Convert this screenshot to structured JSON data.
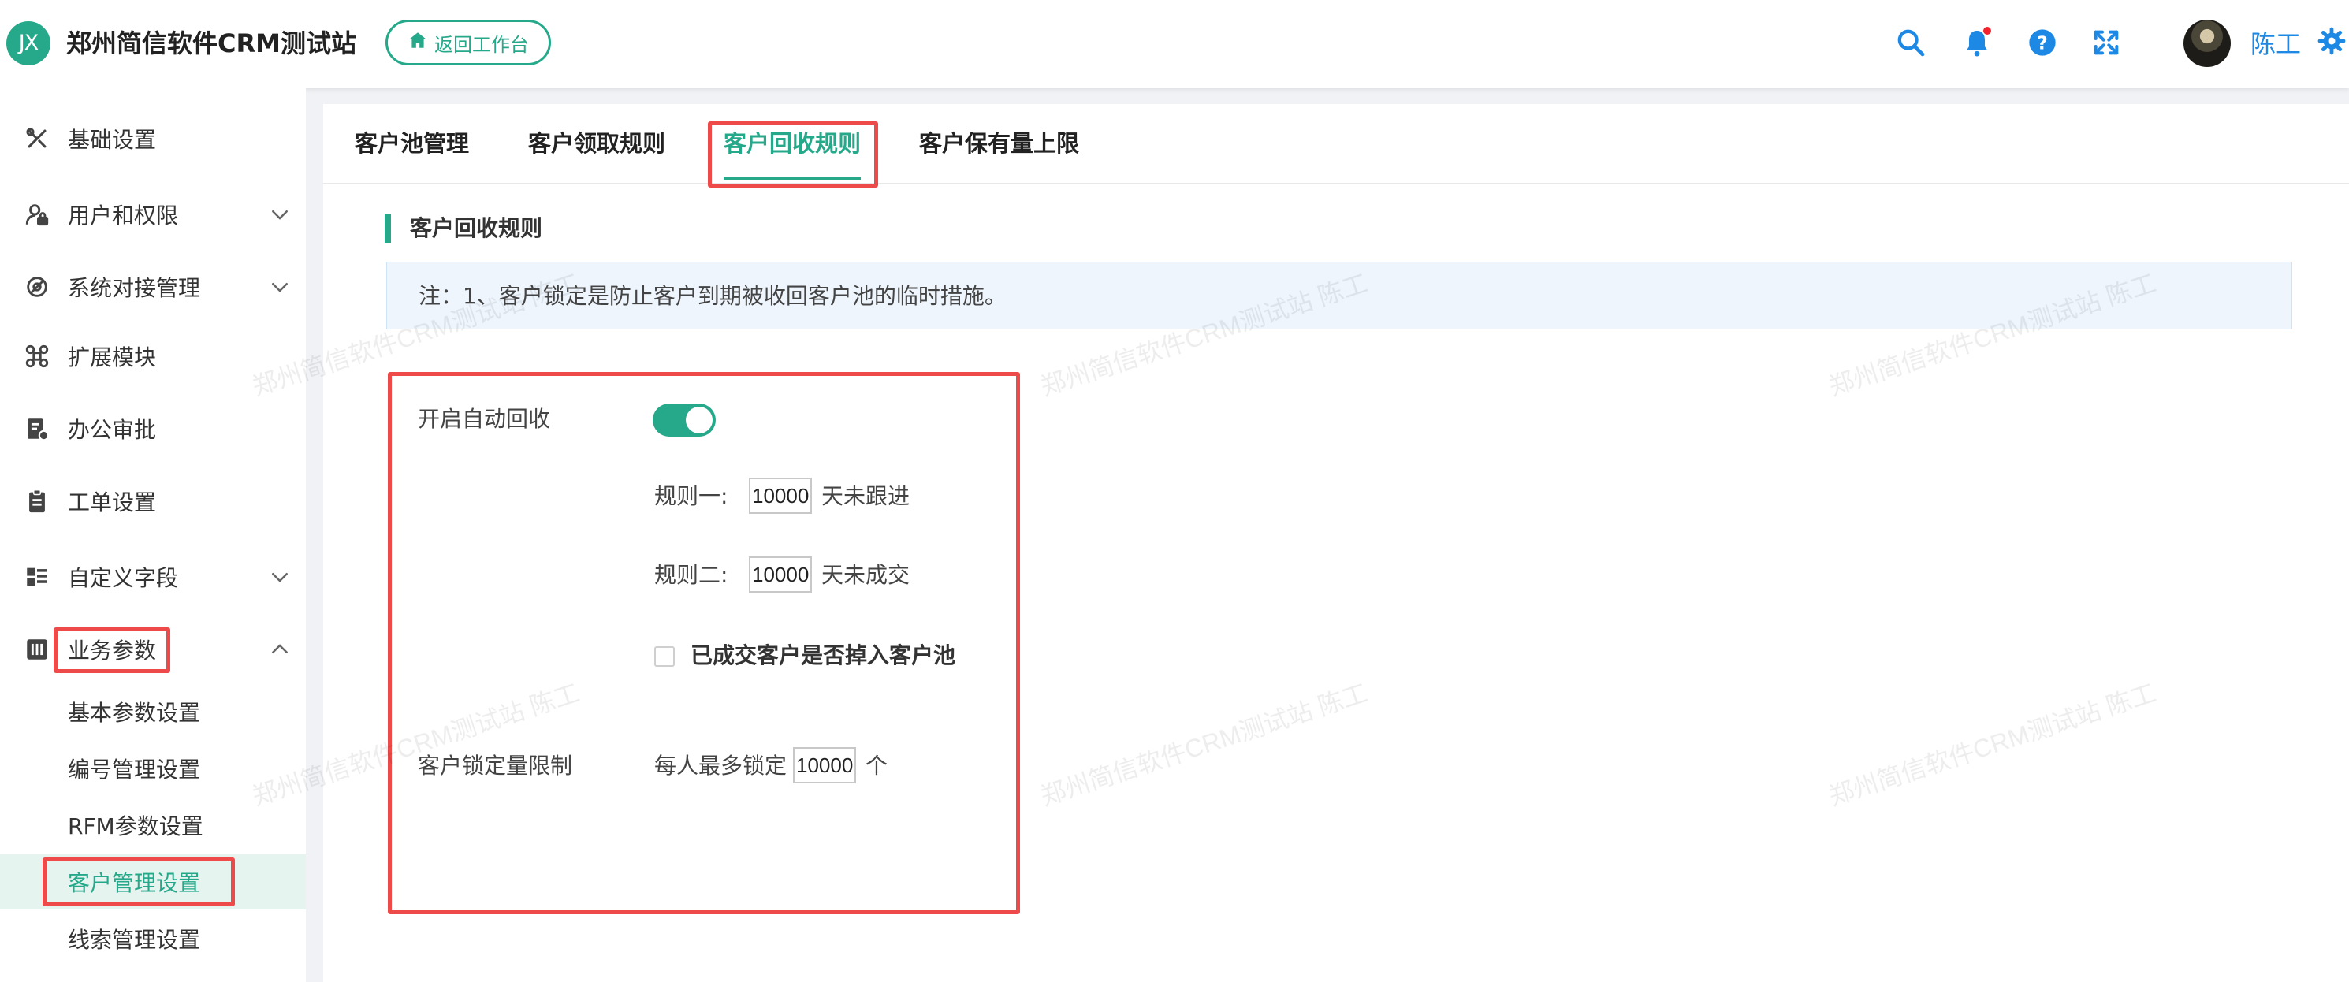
{
  "header": {
    "logo_text": "JX",
    "app_title": "郑州简信软件CRM测试站",
    "back_button": "返回工作台",
    "user_name": "陈工",
    "accent_color": "#26a98a",
    "icons": [
      "search-icon",
      "bell-icon",
      "help-icon",
      "fullscreen-icon",
      "avatar",
      "gear-icon"
    ]
  },
  "sidebar": {
    "items": [
      {
        "label": "基础设置",
        "icon": "wrench-icon"
      },
      {
        "label": "用户和权限",
        "icon": "user-lock-icon"
      },
      {
        "label": "系统对接管理",
        "icon": "link-icon"
      },
      {
        "label": "扩展模块",
        "icon": "command-icon"
      },
      {
        "label": "办公审批",
        "icon": "approval-icon"
      },
      {
        "label": "工单设置",
        "icon": "clipboard-icon"
      },
      {
        "label": "自定义字段",
        "icon": "fields-icon"
      },
      {
        "label": "业务参数",
        "icon": "sliders-icon"
      }
    ],
    "sub_items": [
      {
        "label": "基本参数设置"
      },
      {
        "label": "编号管理设置"
      },
      {
        "label": "RFM参数设置"
      },
      {
        "label": "客户管理设置",
        "active": true
      },
      {
        "label": "线索管理设置"
      }
    ]
  },
  "tabs": [
    {
      "label": "客户池管理"
    },
    {
      "label": "客户领取规则"
    },
    {
      "label": "客户回收规则",
      "active": true
    },
    {
      "label": "客户保有量上限"
    }
  ],
  "section": {
    "title": "客户回收规则",
    "note": "注：1、客户锁定是防止客户到期被收回客户池的临时措施。"
  },
  "form": {
    "auto_recycle_label": "开启自动回收",
    "auto_recycle_on": true,
    "rule1_label": "规则一:",
    "rule1_value": "10000",
    "rule1_suffix": "天未跟进",
    "rule2_label": "规则二:",
    "rule2_value": "10000",
    "rule2_suffix": "天未成交",
    "closed_customer_label": "已成交客户是否掉入客户池",
    "closed_customer_checked": false,
    "lock_limit_label": "客户锁定量限制",
    "lock_prefix": "每人最多锁定",
    "lock_value": "10000",
    "lock_suffix": "个"
  },
  "watermark": "郑州简信软件CRM测试站 陈工"
}
